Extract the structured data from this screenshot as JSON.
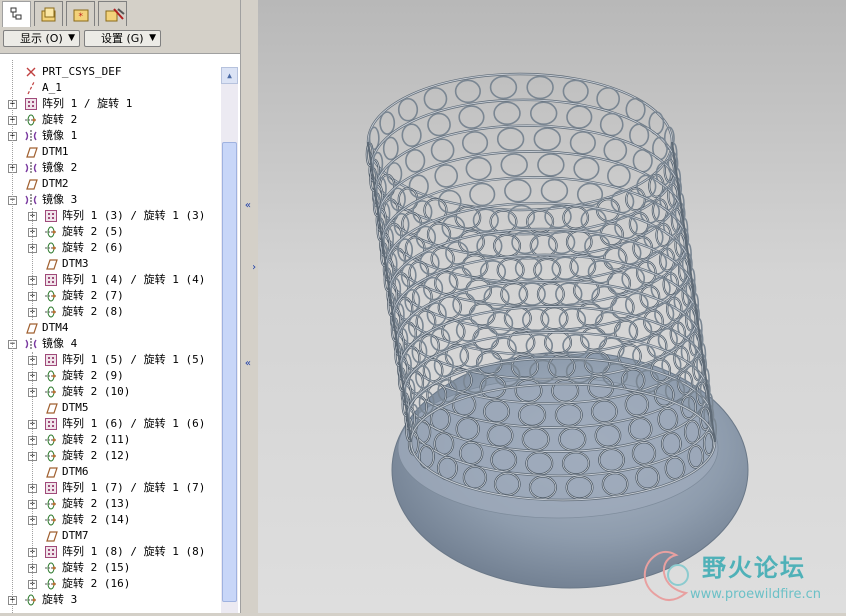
{
  "toolbar": {
    "tabs": [
      {
        "icon": "model-tree-icon",
        "active": true
      },
      {
        "icon": "folder-browser-icon"
      },
      {
        "icon": "favorites-icon"
      },
      {
        "icon": "web-tools-icon"
      }
    ],
    "show_label": "显示 (O)",
    "settings_label": "设置 (G)"
  },
  "tree": {
    "items": [
      {
        "label": "PRT_CSYS_DEF",
        "icon": "csys-icon",
        "level": 0,
        "expander": false
      },
      {
        "label": "A_1",
        "icon": "axis-icon",
        "level": 0,
        "expander": false
      },
      {
        "label": "阵列 1 / 旋转 1",
        "icon": "pattern-icon",
        "level": 0,
        "expander": true
      },
      {
        "label": "旋转 2",
        "icon": "revolve-icon",
        "level": 0,
        "expander": true
      },
      {
        "label": "镜像 1",
        "icon": "mirror-icon",
        "level": 0,
        "expander": true
      },
      {
        "label": "DTM1",
        "icon": "datum-plane-icon",
        "level": 0,
        "expander": false
      },
      {
        "label": "镜像 2",
        "icon": "mirror-icon",
        "level": 0,
        "expander": true
      },
      {
        "label": "DTM2",
        "icon": "datum-plane-icon",
        "level": 0,
        "expander": false
      },
      {
        "label": "镜像 3",
        "icon": "mirror-icon",
        "level": 0,
        "expander": true,
        "open": true
      },
      {
        "label": "阵列 1 (3) / 旋转 1 (3)",
        "icon": "pattern-icon",
        "level": 1,
        "expander": true
      },
      {
        "label": "旋转 2 (5)",
        "icon": "revolve-icon",
        "level": 1,
        "expander": true
      },
      {
        "label": "旋转 2 (6)",
        "icon": "revolve-icon",
        "level": 1,
        "expander": true
      },
      {
        "label": "DTM3",
        "icon": "datum-plane-icon",
        "level": 1,
        "expander": false
      },
      {
        "label": "阵列 1 (4) / 旋转 1 (4)",
        "icon": "pattern-icon",
        "level": 1,
        "expander": true
      },
      {
        "label": "旋转 2 (7)",
        "icon": "revolve-icon",
        "level": 1,
        "expander": true
      },
      {
        "label": "旋转 2 (8)",
        "icon": "revolve-icon",
        "level": 1,
        "expander": true
      },
      {
        "label": "DTM4",
        "icon": "datum-plane-icon",
        "level": 0,
        "expander": false
      },
      {
        "label": "镜像 4",
        "icon": "mirror-icon",
        "level": 0,
        "expander": true,
        "open": true
      },
      {
        "label": "阵列 1 (5) / 旋转 1 (5)",
        "icon": "pattern-icon",
        "level": 1,
        "expander": true
      },
      {
        "label": "旋转 2 (9)",
        "icon": "revolve-icon",
        "level": 1,
        "expander": true
      },
      {
        "label": "旋转 2 (10)",
        "icon": "revolve-icon",
        "level": 1,
        "expander": true
      },
      {
        "label": "DTM5",
        "icon": "datum-plane-icon",
        "level": 1,
        "expander": false
      },
      {
        "label": "阵列 1 (6) / 旋转 1 (6)",
        "icon": "pattern-icon",
        "level": 1,
        "expander": true
      },
      {
        "label": "旋转 2 (11)",
        "icon": "revolve-icon",
        "level": 1,
        "expander": true
      },
      {
        "label": "旋转 2 (12)",
        "icon": "revolve-icon",
        "level": 1,
        "expander": true
      },
      {
        "label": "DTM6",
        "icon": "datum-plane-icon",
        "level": 1,
        "expander": false
      },
      {
        "label": "阵列 1 (7) / 旋转 1 (7)",
        "icon": "pattern-icon",
        "level": 1,
        "expander": true
      },
      {
        "label": "旋转 2 (13)",
        "icon": "revolve-icon",
        "level": 1,
        "expander": true
      },
      {
        "label": "旋转 2 (14)",
        "icon": "revolve-icon",
        "level": 1,
        "expander": true
      },
      {
        "label": "DTM7",
        "icon": "datum-plane-icon",
        "level": 1,
        "expander": false
      },
      {
        "label": "阵列 1 (8) / 旋转 1 (8)",
        "icon": "pattern-icon",
        "level": 1,
        "expander": true
      },
      {
        "label": "旋转 2 (15)",
        "icon": "revolve-icon",
        "level": 1,
        "expander": true
      },
      {
        "label": "旋转 2 (16)",
        "icon": "revolve-icon",
        "level": 1,
        "expander": true
      },
      {
        "label": "旋转 3",
        "icon": "revolve-icon",
        "level": 0,
        "expander": true
      }
    ]
  },
  "viewport": {
    "model": "3d-pen-holder-model",
    "background": "#d0d0d0",
    "model_color": "#8c9aa8"
  },
  "watermark": {
    "title": "野火论坛",
    "url": "www.proewildfire.cn"
  }
}
